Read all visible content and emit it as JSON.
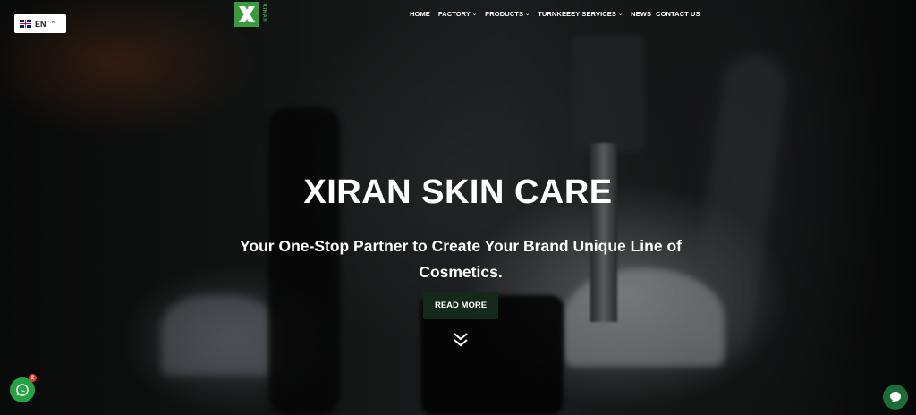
{
  "language": {
    "code": "EN",
    "flag": "uk-flag-icon"
  },
  "logo": {
    "mark": "X",
    "text": "XIRAN",
    "brand_color": "#3a9a3e"
  },
  "nav": {
    "items": [
      {
        "label": "HOME",
        "has_dropdown": false
      },
      {
        "label": "FACTORY",
        "has_dropdown": true
      },
      {
        "label": "PRODUCTS",
        "has_dropdown": true
      },
      {
        "label": "TURNKEEEY SERVICES",
        "has_dropdown": true
      },
      {
        "label": "NEWS",
        "has_dropdown": false
      },
      {
        "label": "CONTACT US",
        "has_dropdown": false
      }
    ]
  },
  "hero": {
    "title": "XIRAN SKIN CARE",
    "subtitle": "Your One-Stop Partner to Create Your Brand Unique Line of Cosmetics.",
    "button_label": "READ MORE",
    "button_color": "#14291a"
  },
  "whatsapp": {
    "badge_count": "2",
    "color": "#25a244"
  },
  "chat": {
    "color": "#1e6b3a"
  }
}
